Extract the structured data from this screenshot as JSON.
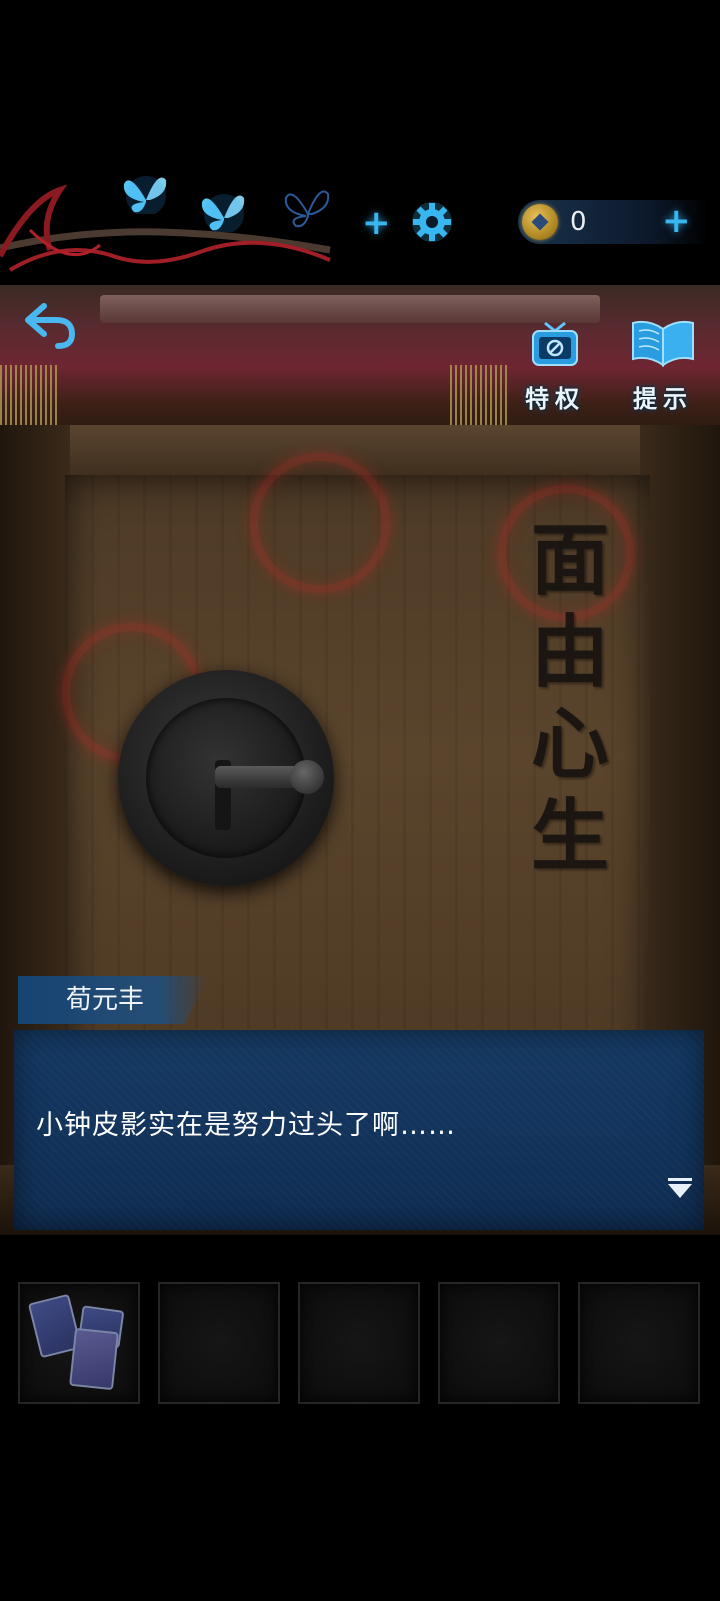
{
  "hud": {
    "butterflies": [
      "butterfly-lit",
      "butterfly-lit",
      "butterfly-empty"
    ],
    "add_energy_label": "+",
    "coin_count": "0",
    "add_coin_label": "+"
  },
  "scene": {
    "inscription": [
      "面",
      "由",
      "心",
      "生"
    ]
  },
  "buttons": {
    "privilege_label": "特权",
    "hint_label": "提示"
  },
  "dialog": {
    "speaker": "荀元丰",
    "text": "小钟皮影实在是努力过头了啊……"
  },
  "inventory": {
    "slots": [
      "cards",
      "empty",
      "empty",
      "empty",
      "empty"
    ]
  },
  "colors": {
    "accent_blue": "#38b6f0",
    "dialog_blue": "#143a66",
    "warning_red": "#c82828"
  }
}
